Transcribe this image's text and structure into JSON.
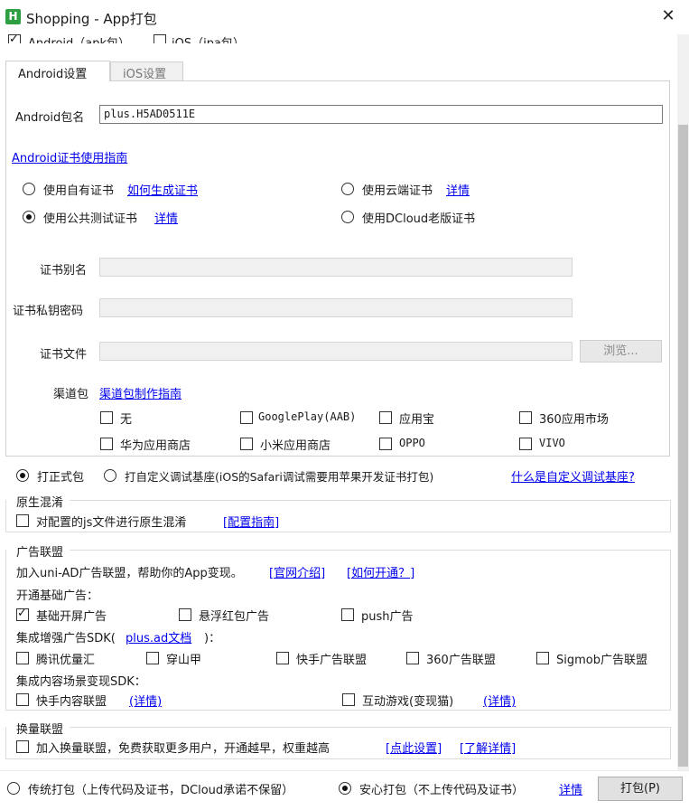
{
  "window": {
    "title": "Shopping - App打包",
    "app_icon": "H"
  },
  "platforms": {
    "android": "Android（apk包）",
    "ios": "iOS（ipa包）"
  },
  "tabs": [
    {
      "label": "Android设置",
      "active": true
    },
    {
      "label": "iOS设置",
      "active": false
    }
  ],
  "android": {
    "package_label": "Android包名",
    "package_value": "plus.H5AD0511E",
    "cert_guide": "Android证书使用指南",
    "cert_options": {
      "own": "使用自有证书",
      "own_link": "如何生成证书",
      "cloud": "使用云端证书",
      "cloud_link": "详情",
      "public": "使用公共测试证书",
      "public_link": "详情",
      "dcloud_old": "使用DCloud老版证书"
    },
    "alias_label": "证书别名",
    "password_label": "证书私钥密码",
    "file_label": "证书文件",
    "browse_button": "浏览...",
    "channel_label": "渠道包",
    "channel_guide": "渠道包制作指南",
    "channels": [
      "无",
      "GooglePlay(AAB)",
      "应用宝",
      "360应用市场",
      "华为应用商店",
      "小米应用商店",
      "OPPO",
      "VIVO"
    ]
  },
  "build_type": {
    "formal": "打正式包",
    "custom": "打自定义调试基座(iOS的Safari调试需要用苹果开发证书打包)",
    "custom_link": "什么是自定义调试基座?"
  },
  "obfuscation": {
    "title": "原生混淆",
    "checkbox": "对配置的js文件进行原生混淆",
    "link": "[配置指南]"
  },
  "ads": {
    "title": "广告联盟",
    "intro": "加入uni-AD广告联盟，帮助你的App变现。",
    "link_official": "[官网介绍]",
    "link_howto": "[如何开通？]",
    "basic_title": "开通基础广告：",
    "basic": [
      {
        "label": "基础开屏广告",
        "checked": true
      },
      {
        "label": "悬浮红包广告",
        "checked": false
      },
      {
        "label": "push广告",
        "checked": false
      }
    ],
    "sdk_title_prefix": "集成增强广告SDK(",
    "sdk_title_link": "plus.ad文档",
    "sdk_title_suffix": ")：",
    "sdk": [
      "腾讯优量汇",
      "穿山甲",
      "快手广告联盟",
      "360广告联盟",
      "Sigmob广告联盟"
    ],
    "content_title": "集成内容场景变现SDK：",
    "content": [
      {
        "label": "快手内容联盟",
        "link": "(详情)"
      },
      {
        "label": "互动游戏(变现猫)",
        "link": "(详情)"
      }
    ]
  },
  "exchange": {
    "title": "换量联盟",
    "checkbox": "加入换量联盟，免费获取更多用户，开通越早，权重越高",
    "link_set": "[点此设置]",
    "link_detail": "[了解详情]"
  },
  "footer": {
    "traditional": "传统打包（上传代码及证书，DCloud承诺不保留）",
    "safe": "安心打包（不上传代码及证书）",
    "detail_link": "详情",
    "pack_button": "打包(P)"
  }
}
